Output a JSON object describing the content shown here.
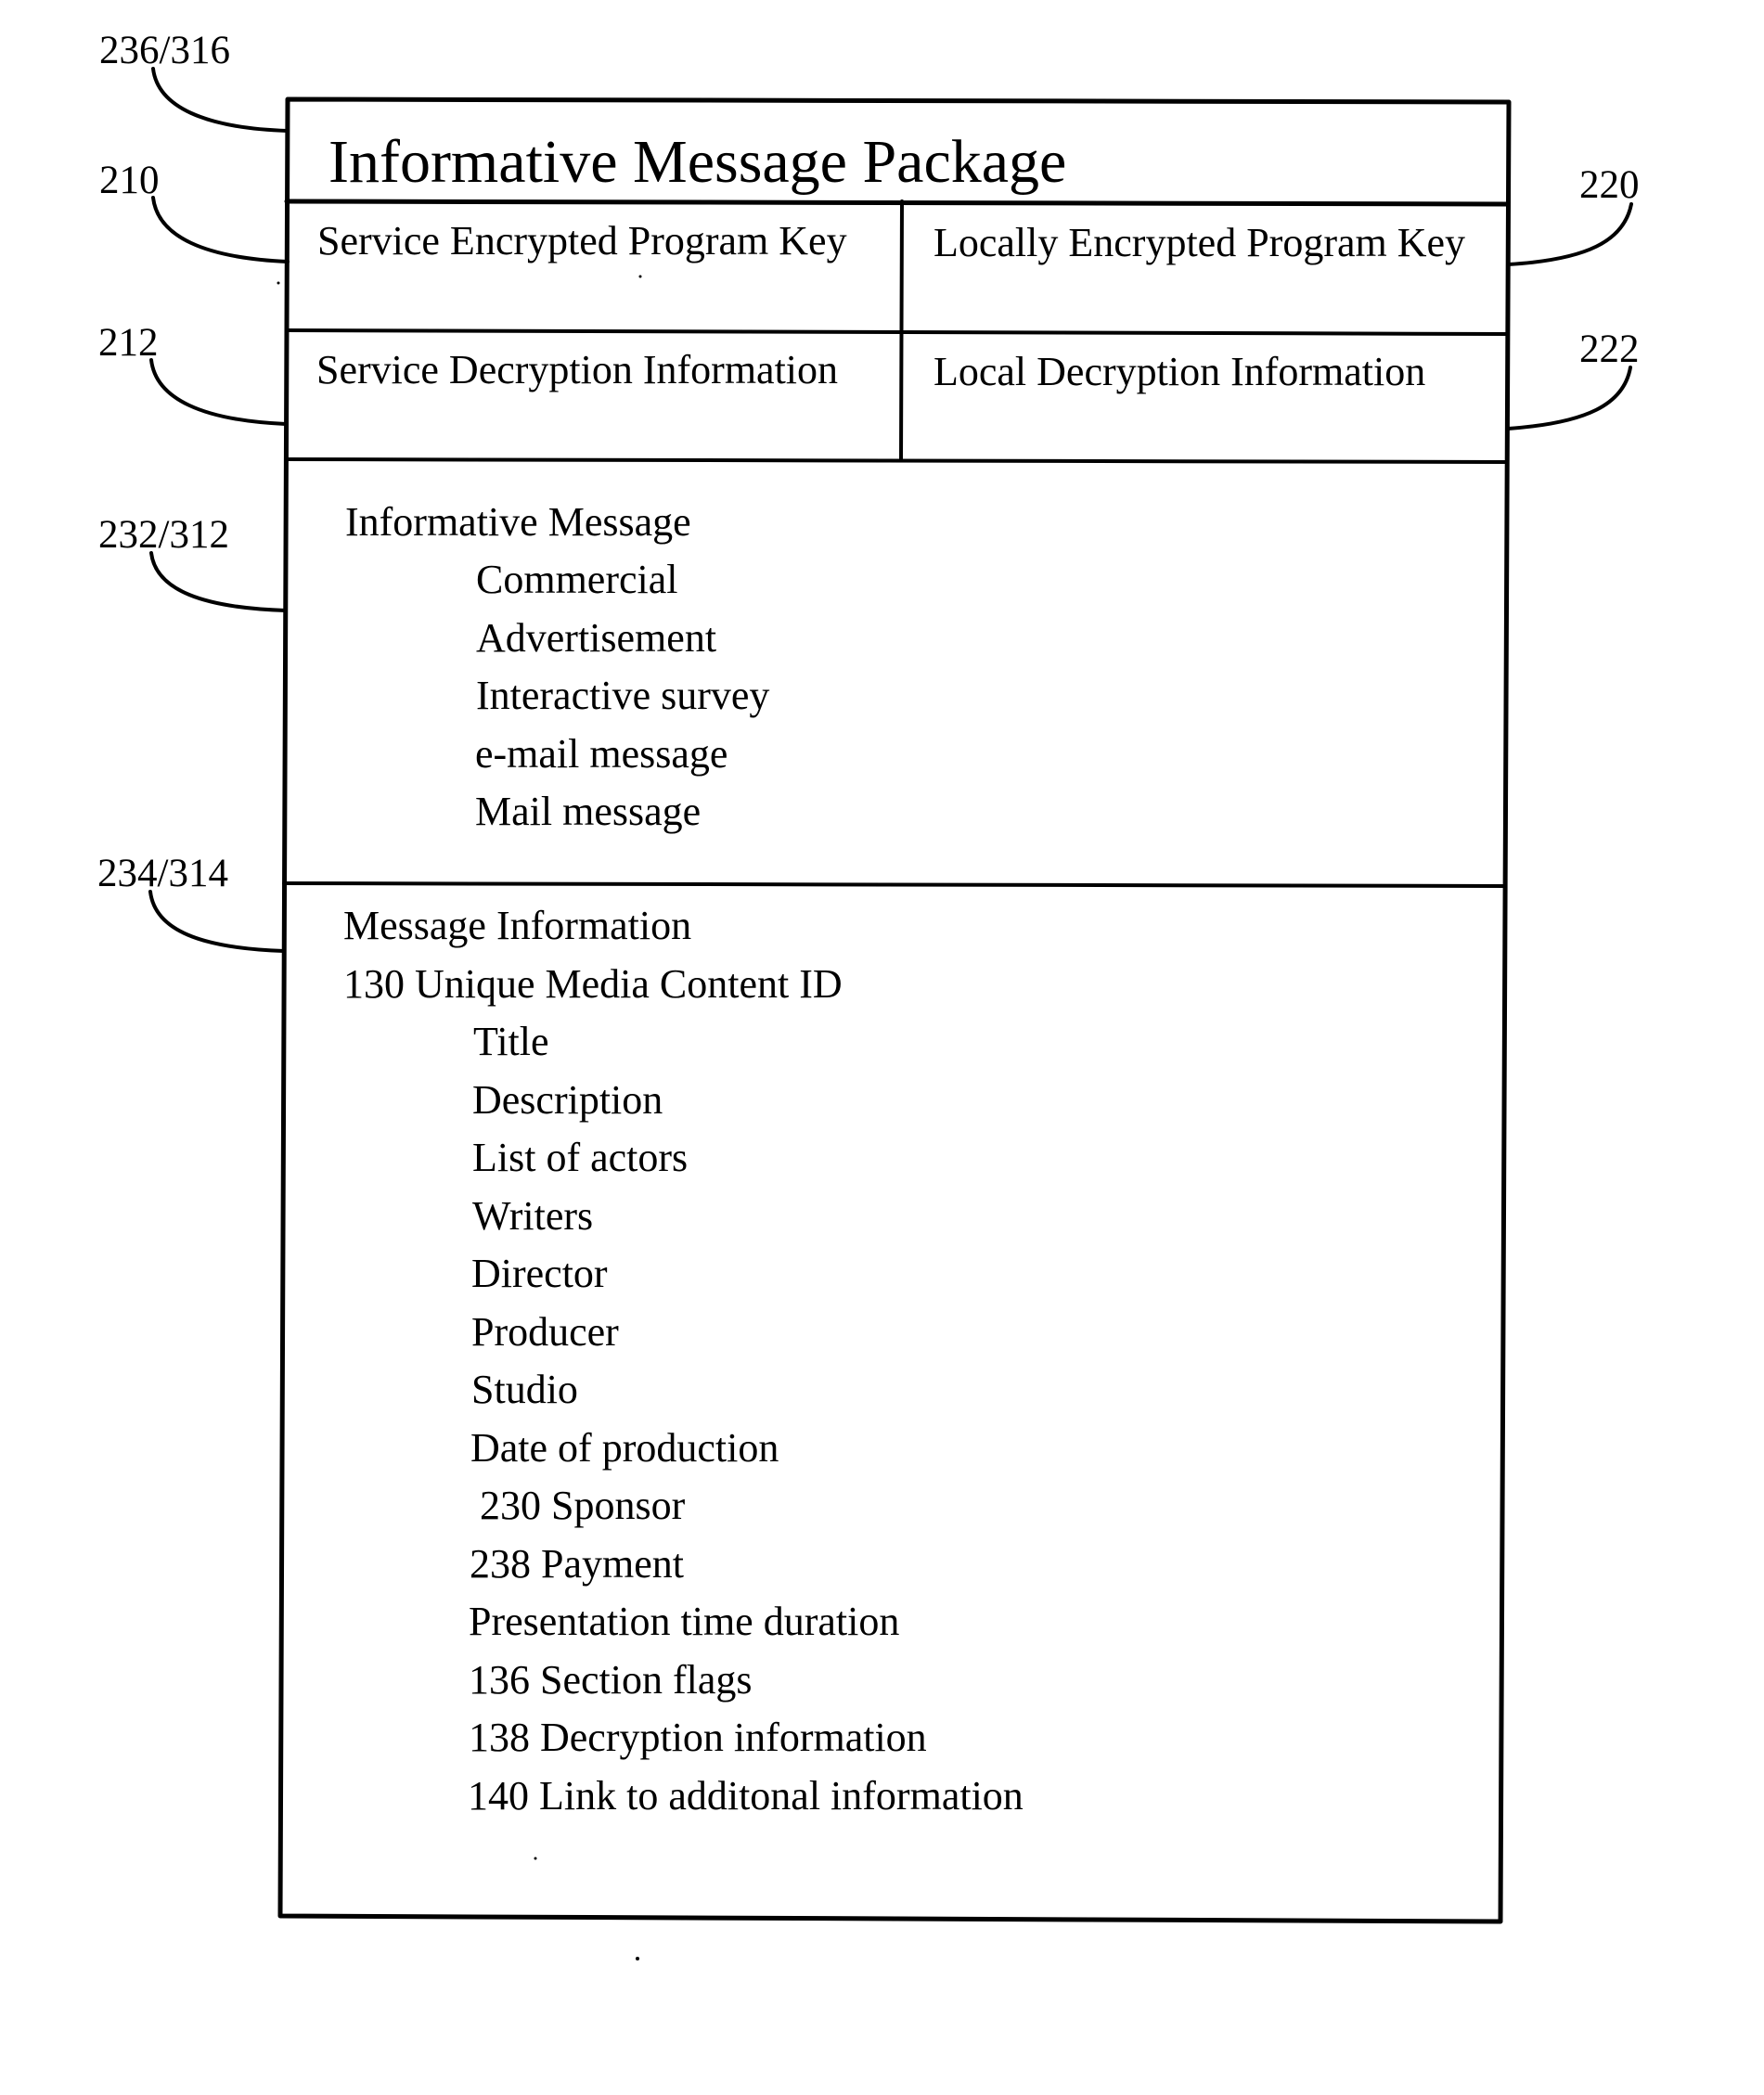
{
  "figure": {
    "title": "Informative Message Package",
    "reference_labels": {
      "package": "236/316",
      "service_key": "210",
      "service_decryption": "212",
      "local_key": "220",
      "local_decryption": "222",
      "informative_message": "232/312",
      "message_information": "234/314"
    },
    "rows": [
      {
        "left": "Service Encrypted Program Key",
        "right": "Locally Encrypted Program Key"
      },
      {
        "left": "Service Decryption Information",
        "right": "Local Decryption Information"
      }
    ],
    "informative_message": {
      "heading": "Informative Message",
      "items": [
        "Commercial",
        "Advertisement",
        "Interactive survey",
        "e-mail message",
        "Mail message"
      ]
    },
    "message_information": {
      "heading": "Message Information",
      "subheading": "130 Unique Media Content ID",
      "items": [
        "Title",
        "Description",
        "List of actors",
        "Writers",
        "Director",
        "Producer",
        "Studio",
        "Date of production",
        "230 Sponsor",
        "238 Payment",
        "Presentation time duration",
        "136 Section flags",
        "138 Decryption information",
        "140 Link to additonal information"
      ]
    }
  }
}
